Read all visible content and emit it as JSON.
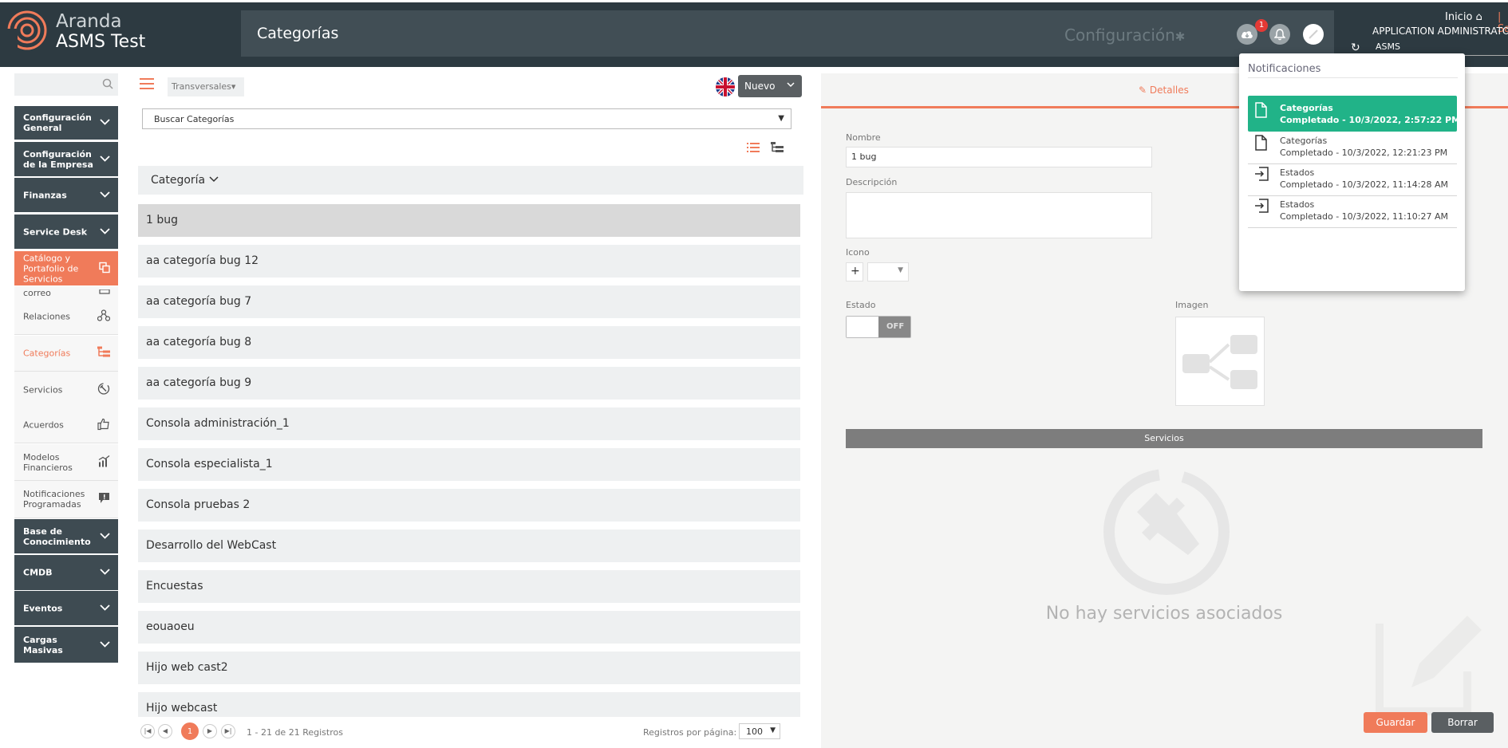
{
  "header": {
    "brand_line1": "Aranda",
    "brand_line2": "ASMS Test",
    "page_title": "Categorías",
    "config_link": "Configuración",
    "notification_count": "1",
    "home_link": "Inicio",
    "sa_link": "| Sa",
    "user_role": "APPLICATION ADMINISTRATO",
    "project_select": "ASMS"
  },
  "colors": {
    "accent": "#f07b5a",
    "dark": "#2d3a41",
    "success": "#21b388"
  },
  "sidebar": {
    "items": [
      {
        "label": "Configuración General",
        "kind": "dark",
        "icon": "chevron-down-icon"
      },
      {
        "label": "Configuración de la Empresa",
        "kind": "dark",
        "icon": "chevron-down-icon"
      },
      {
        "label": "Finanzas",
        "kind": "dark",
        "icon": "chevron-down-icon"
      },
      {
        "label": "Service Desk",
        "kind": "dark",
        "icon": "chevron-down-icon"
      },
      {
        "label": "Catálogo y Portafolio de Servicios",
        "kind": "active",
        "icon": "copy-icon"
      },
      {
        "label": "correo",
        "kind": "light",
        "icon": "mail-icon"
      },
      {
        "label": "Relaciones",
        "kind": "light",
        "icon": "relations-icon"
      },
      {
        "label": "Categorías",
        "kind": "light-sel",
        "icon": "tree-icon"
      },
      {
        "label": "Servicios",
        "kind": "light",
        "icon": "tools-icon"
      },
      {
        "label": "Acuerdos",
        "kind": "light",
        "icon": "thumbs-up-icon"
      },
      {
        "label": "Modelos Financieros",
        "kind": "light",
        "icon": "chart-icon"
      },
      {
        "label": "Notificaciones Programadas",
        "kind": "light",
        "icon": "alert-message-icon"
      },
      {
        "label": "Base de Conocimiento",
        "kind": "dark",
        "icon": "chevron-down-icon"
      },
      {
        "label": "CMDB",
        "kind": "dark",
        "icon": "chevron-down-icon"
      },
      {
        "label": "Eventos",
        "kind": "dark",
        "icon": "chevron-down-icon"
      },
      {
        "label": "Cargas Masivas",
        "kind": "dark",
        "icon": "chevron-down-icon"
      }
    ]
  },
  "list": {
    "filter_select": "Transversales",
    "new_button": "Nuevo",
    "search_placeholder": "Buscar Categorías",
    "column_header": "Categoría",
    "rows": [
      "1 bug",
      "aa categoría bug 12",
      "aa categoría bug 7",
      "aa categoría bug 8",
      "aa categoría bug 9",
      "Consola administración_1",
      "Consola especialista_1",
      "Consola pruebas 2",
      "Desarrollo del WebCast",
      "Encuestas",
      "eouaoeu",
      "Hijo web cast2",
      "Hijo webcast"
    ],
    "selected_index": 0,
    "pager": {
      "current_page": "1",
      "info": "1 - 21 de 21 Registros",
      "per_page_label": "Registros por página:",
      "per_page_value": "100"
    }
  },
  "details": {
    "tab_label": "Detalles",
    "name_label": "Nombre",
    "name_value": "1 bug",
    "description_label": "Descripción",
    "description_value": "",
    "icon_label": "Icono",
    "icon_add": "+",
    "state_label": "Estado",
    "state_value": "OFF",
    "image_label": "Imagen",
    "services_bar": "Servicios",
    "no_services": "No hay servicios asociados",
    "save_button": "Guardar",
    "delete_button": "Borrar"
  },
  "notifications": {
    "title": "Notificaciones",
    "items": [
      {
        "title": "Categorías",
        "status": "Completado - 10/3/2022, 2:57:22 PM",
        "icon": "file-icon",
        "highlight": true
      },
      {
        "title": "Categorías",
        "status": "Completado - 10/3/2022, 12:21:23 PM",
        "icon": "file-icon",
        "highlight": false
      },
      {
        "title": "Estados",
        "status": "Completado - 10/3/2022, 11:14:28 AM",
        "icon": "import-icon",
        "highlight": false
      },
      {
        "title": "Estados",
        "status": "Completado - 10/3/2022, 11:10:27 AM",
        "icon": "import-icon",
        "highlight": false
      }
    ]
  }
}
